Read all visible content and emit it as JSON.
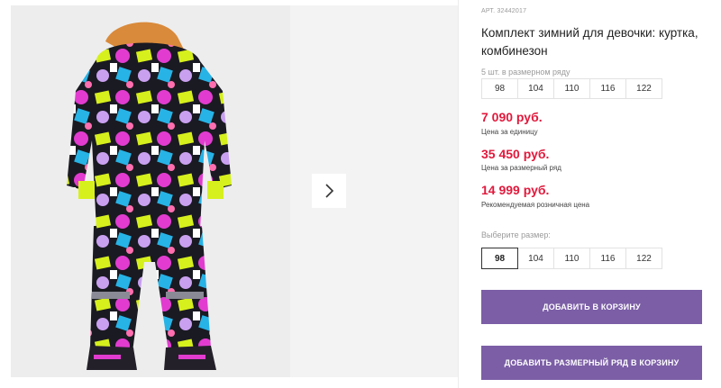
{
  "product": {
    "sku_label": "АРТ.",
    "sku_value": "32442017",
    "title": "Комплект зимний для девочки: куртка, комбинезон"
  },
  "size_row": {
    "caption": "5 шт. в размерном ряду",
    "sizes": [
      "98",
      "104",
      "110",
      "116",
      "122"
    ]
  },
  "prices": {
    "unit_price": "7 090 руб.",
    "unit_note": "Цена за единицу",
    "row_price": "35 450 руб.",
    "row_note": "Цена за размерный ряд",
    "retail_price": "14 999 руб.",
    "retail_note": "Рекомендуемая розничная цена",
    "price_color": "#e1193c"
  },
  "size_picker": {
    "caption": "Выберите размер:",
    "sizes": [
      "98",
      "104",
      "110",
      "116",
      "122"
    ],
    "selected": "98"
  },
  "actions": {
    "add_to_cart": "ДОБАВИТЬ В КОРЗИНУ",
    "add_row_to_cart": "ДОБАВИТЬ РАЗМЕРНЫЙ РЯД В КОРЗИНУ",
    "accent": "#7b5ea6"
  },
  "gallery": {
    "next_icon": "chevron-right-icon"
  }
}
